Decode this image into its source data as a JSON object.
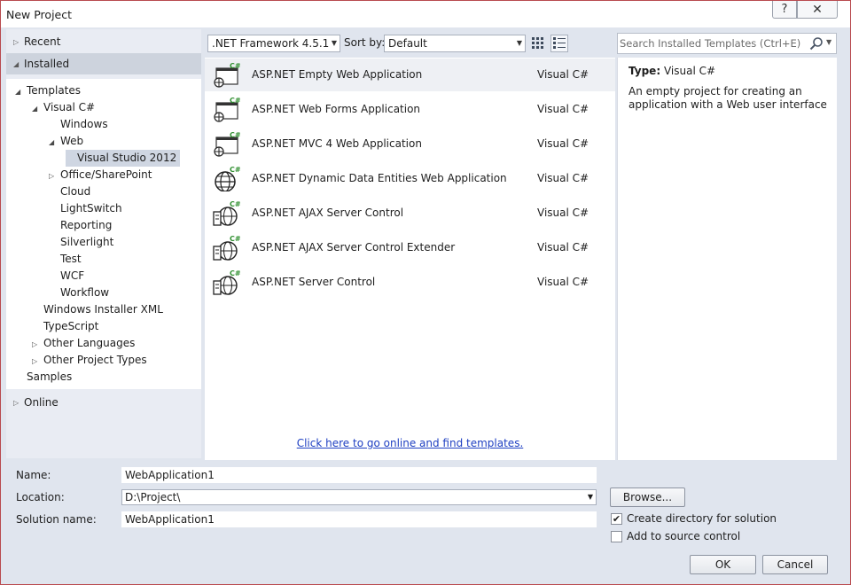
{
  "window": {
    "title": "New Project",
    "help_glyph": "?",
    "close_glyph": "✕"
  },
  "left_panel": {
    "recent": "Recent",
    "installed": "Installed",
    "online": "Online",
    "tree": [
      {
        "label": "Templates",
        "indent": 0,
        "expander": "expanded"
      },
      {
        "label": "Visual C#",
        "indent": 1,
        "expander": "expanded"
      },
      {
        "label": "Windows",
        "indent": 2,
        "expander": "none"
      },
      {
        "label": "Web",
        "indent": 2,
        "expander": "expanded"
      },
      {
        "label": "Visual Studio 2012",
        "indent": 3,
        "expander": "none",
        "selected": true
      },
      {
        "label": "Office/SharePoint",
        "indent": 2,
        "expander": "collapsed"
      },
      {
        "label": "Cloud",
        "indent": 2,
        "expander": "none"
      },
      {
        "label": "LightSwitch",
        "indent": 2,
        "expander": "none"
      },
      {
        "label": "Reporting",
        "indent": 2,
        "expander": "none"
      },
      {
        "label": "Silverlight",
        "indent": 2,
        "expander": "none"
      },
      {
        "label": "Test",
        "indent": 2,
        "expander": "none"
      },
      {
        "label": "WCF",
        "indent": 2,
        "expander": "none"
      },
      {
        "label": "Workflow",
        "indent": 2,
        "expander": "none"
      },
      {
        "label": "Windows Installer XML",
        "indent": 1,
        "expander": "none"
      },
      {
        "label": "TypeScript",
        "indent": 1,
        "expander": "none"
      },
      {
        "label": "Other Languages",
        "indent": 1,
        "expander": "collapsed"
      },
      {
        "label": "Other Project Types",
        "indent": 1,
        "expander": "collapsed"
      },
      {
        "label": "Samples",
        "indent": 0,
        "expander": "none"
      }
    ]
  },
  "toolbar": {
    "framework": ".NET Framework 4.5.1",
    "sort_by_label": "Sort by:",
    "sort_by_value": "Default",
    "view_modes": [
      "small-icons-view-icon",
      "list-view-icon"
    ]
  },
  "templates": [
    {
      "name": "ASP.NET Empty Web Application",
      "language": "Visual C#",
      "icon": "web-app-icon",
      "selected": true
    },
    {
      "name": "ASP.NET Web Forms Application",
      "language": "Visual C#",
      "icon": "web-app-icon"
    },
    {
      "name": "ASP.NET MVC 4 Web Application",
      "language": "Visual C#",
      "icon": "web-app-icon"
    },
    {
      "name": "ASP.NET Dynamic Data Entities Web Application",
      "language": "Visual C#",
      "icon": "globe-icon"
    },
    {
      "name": "ASP.NET AJAX Server Control",
      "language": "Visual C#",
      "icon": "server-control-icon"
    },
    {
      "name": "ASP.NET AJAX Server Control Extender",
      "language": "Visual C#",
      "icon": "server-control-icon"
    },
    {
      "name": "ASP.NET Server Control",
      "language": "Visual C#",
      "icon": "server-control-icon"
    }
  ],
  "online_link": "Click here to go online and find templates.",
  "search": {
    "placeholder": "Search Installed Templates (Ctrl+E)"
  },
  "details": {
    "type_label": "Type:",
    "type_value": "Visual C#",
    "description": "An empty project for creating an application with a Web user interface"
  },
  "form": {
    "name_label": "Name:",
    "name_value": "WebApplication1",
    "location_label": "Location:",
    "location_value": "D:\\Project\\",
    "solution_label": "Solution name:",
    "solution_value": "WebApplication1",
    "browse_label": "Browse...",
    "create_dir_label": "Create directory for solution",
    "create_dir_checked": true,
    "source_control_label": "Add to source control",
    "source_control_checked": false,
    "ok_label": "OK",
    "cancel_label": "Cancel"
  },
  "colors": {
    "accent_link": "#1e3fc2",
    "selection": "#cfd6e2",
    "panel": "#e0e5ee"
  }
}
